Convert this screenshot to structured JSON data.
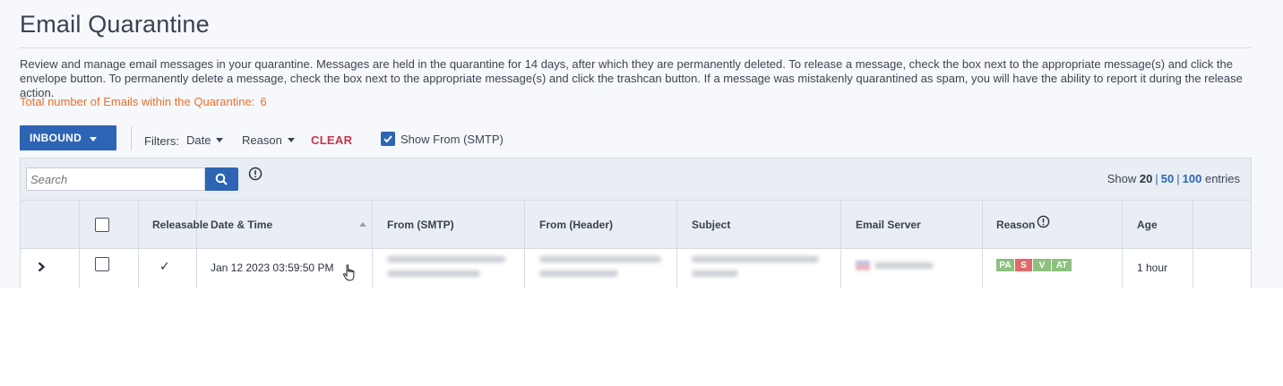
{
  "page": {
    "title": "Email Quarantine",
    "description": "Review and manage email messages in your quarantine. Messages are held in the quarantine for 14 days, after which they are permanently deleted. To release a message, check the box next to the appropriate message(s) and click the envelope button. To permanently delete a message, check the box next to the appropriate message(s) and click the trashcan button. If a message was mistakenly quarantined as spam, you will have the ability to report it during the release action.",
    "total_label": "Total number of Emails within the Quarantine:",
    "total_count": "6"
  },
  "toolbar": {
    "direction_label": "INBOUND",
    "filters_label": "Filters:",
    "filter_date": "Date",
    "filter_reason": "Reason",
    "clear_label": "CLEAR",
    "show_from_label": "Show From (SMTP)",
    "show_from_checked": true
  },
  "search": {
    "placeholder": "Search"
  },
  "entries": {
    "show": "Show",
    "selected": "20",
    "opt_50": "50",
    "opt_100": "100",
    "suffix": "entries"
  },
  "table": {
    "columns": [
      "Releasable",
      "Date & Time",
      "From (SMTP)",
      "From (Header)",
      "Subject",
      "Email Server",
      "Reason",
      "Age"
    ],
    "rows": [
      {
        "releasable": "✓",
        "datetime": "Jan 12 2023 03:59:50 PM",
        "age": "1 hour",
        "reasons": [
          {
            "code": "PA",
            "color": "#8cc17e"
          },
          {
            "code": "S",
            "color": "#e06a6a"
          },
          {
            "code": "V",
            "color": "#8cc17e"
          },
          {
            "code": "AT",
            "color": "#8cc17e"
          }
        ]
      }
    ]
  },
  "colors": {
    "accent": "#2d64b3",
    "total": "#e8702a",
    "clear": "#c8334a"
  }
}
